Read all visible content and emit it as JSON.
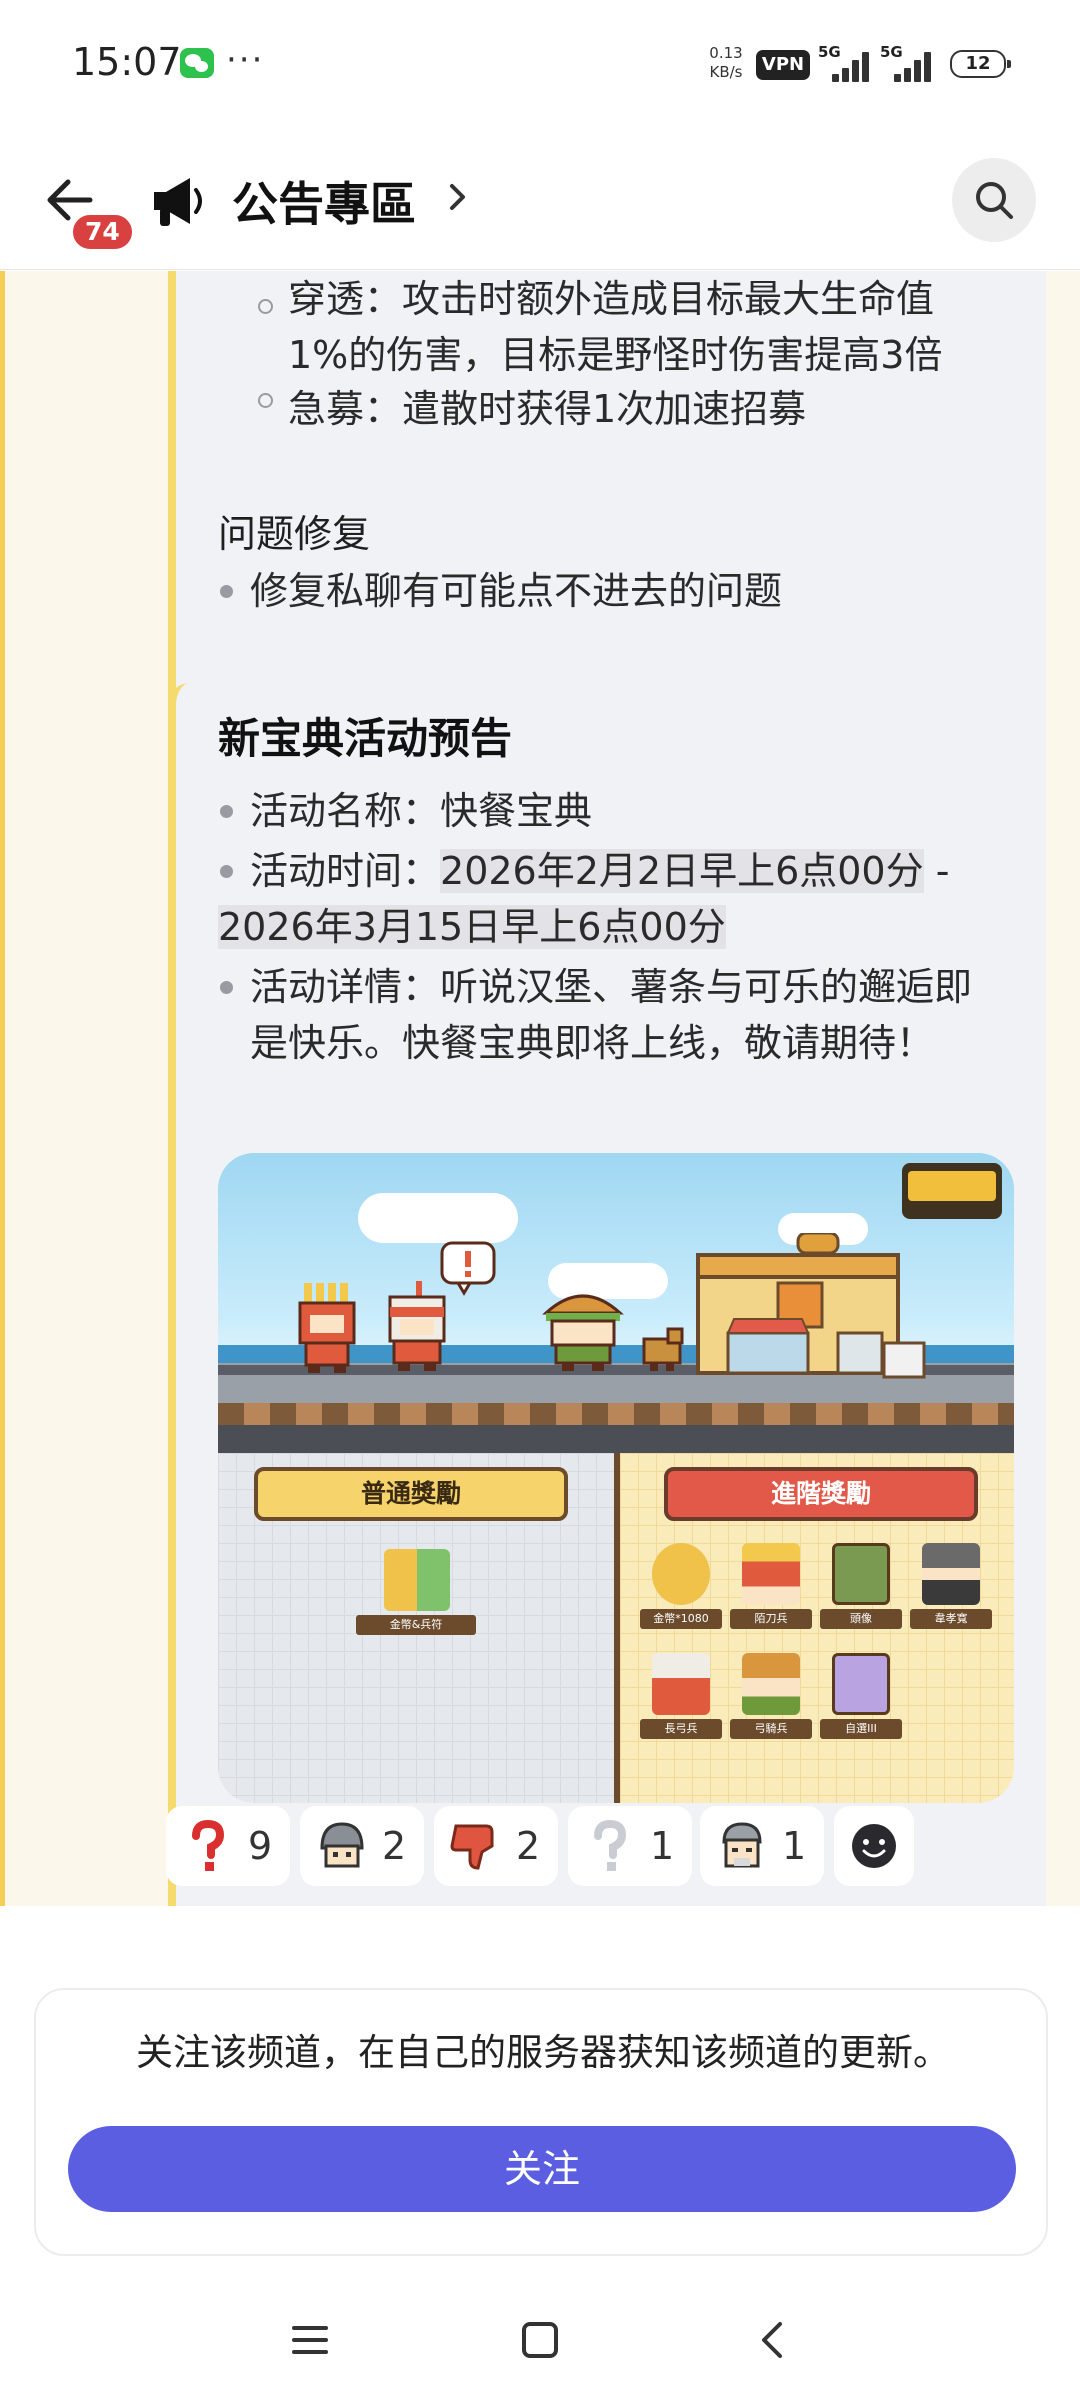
{
  "status": {
    "time": "15:07",
    "dots": "···",
    "speed_value": "0.13",
    "speed_unit": "KB/s",
    "vpn": "VPN",
    "net1": "5G",
    "net2": "5G",
    "battery": "12"
  },
  "header": {
    "badge": "74",
    "title": "公告專區"
  },
  "top_card": {
    "sub_item_1_line1": "穿透：攻击时额外造成目标最大生命值",
    "sub_item_1_line2": "1%的伤害，目标是野怪时伤害提高3倍",
    "sub_item_2": "急募：遣散时获得1次加速招募",
    "fix_heading": "问题修复",
    "fix_item": "修复私聊有可能点不进去的问题"
  },
  "main_card": {
    "title": "新宝典活动预告",
    "name_label": "活动名称：",
    "name_value": "快餐宝典",
    "time_label": "活动时间：",
    "time_start": "2026年2月2日早上6点00分",
    "time_sep": " -",
    "time_end": "2026年3月15日早上6点00分",
    "detail_line1": "活动详情：听说汉堡、薯条与可乐的邂逅即",
    "detail_line2": "是快乐。快餐宝典即将上线，敬请期待！"
  },
  "event_image": {
    "normal_header": "普通獎勵",
    "adv_header": "進階獎勵",
    "normal_rewards": [
      "金幣&兵符"
    ],
    "adv_rewards": [
      "金幣*1080",
      "陌刀兵",
      "頭像",
      "韋孝寬",
      "長弓兵",
      "弓騎兵",
      "自選III"
    ]
  },
  "reactions": [
    {
      "icon": "red-question-icon",
      "count": "9"
    },
    {
      "icon": "helmet-avatar-icon",
      "count": "2"
    },
    {
      "icon": "thumbs-down-icon",
      "count": "2"
    },
    {
      "icon": "grey-question-icon",
      "count": "1"
    },
    {
      "icon": "old-man-avatar-icon",
      "count": "1"
    },
    {
      "icon": "add-emoji-icon"
    }
  ],
  "follow": {
    "text": "关注该频道，在自己的服务器获知该频道的更新。",
    "button": "关注"
  },
  "colors": {
    "accent": "#5b5ee0",
    "badge": "#d94040",
    "card_border": "#f5db6e"
  }
}
